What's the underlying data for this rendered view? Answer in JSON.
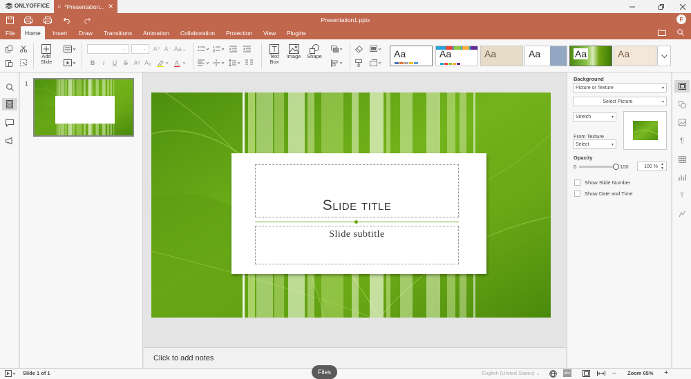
{
  "brand": "ONLYOFFICE",
  "tab": {
    "label": "*Presentation...",
    "close": "✕"
  },
  "window": {
    "title": "Presentation1.pptx"
  },
  "user": {
    "initial": "F"
  },
  "menu": [
    "File",
    "Home",
    "Insert",
    "Draw",
    "Transitions",
    "Animation",
    "Collaboration",
    "Protection",
    "View",
    "Plugins"
  ],
  "active_menu": "Home",
  "toolbar": {
    "add_slide": "Add Slide",
    "text_box": "Text Box",
    "image": "Image",
    "shape": "Shape",
    "themes": [
      "Aa",
      "Aa",
      "Aa",
      "Aa",
      "Aa",
      "Aa"
    ]
  },
  "slides": {
    "number": "1"
  },
  "slide": {
    "title": "Slide title",
    "subtitle": "Slide subtitle"
  },
  "notes": {
    "placeholder": "Click to add notes"
  },
  "panel": {
    "background_label": "Background",
    "fill_type": "Picture or Texture",
    "select_picture": "Select Picture",
    "stretch": "Stretch",
    "from_texture_label": "From Texture",
    "texture_select": "Select",
    "opacity_label": "Opacity",
    "opacity_min": "0",
    "opacity_max": "100",
    "opacity_value": "100 %",
    "show_slide_number": "Show Slide Number",
    "show_date_time": "Show Date and Time"
  },
  "status": {
    "slide_info": "Slide 1 of 1",
    "files": "Files",
    "language": "English (United States)",
    "zoom": "Zoom 65%"
  },
  "colors": {
    "accent": "#c0674d",
    "slide_green": "#6ea512"
  }
}
